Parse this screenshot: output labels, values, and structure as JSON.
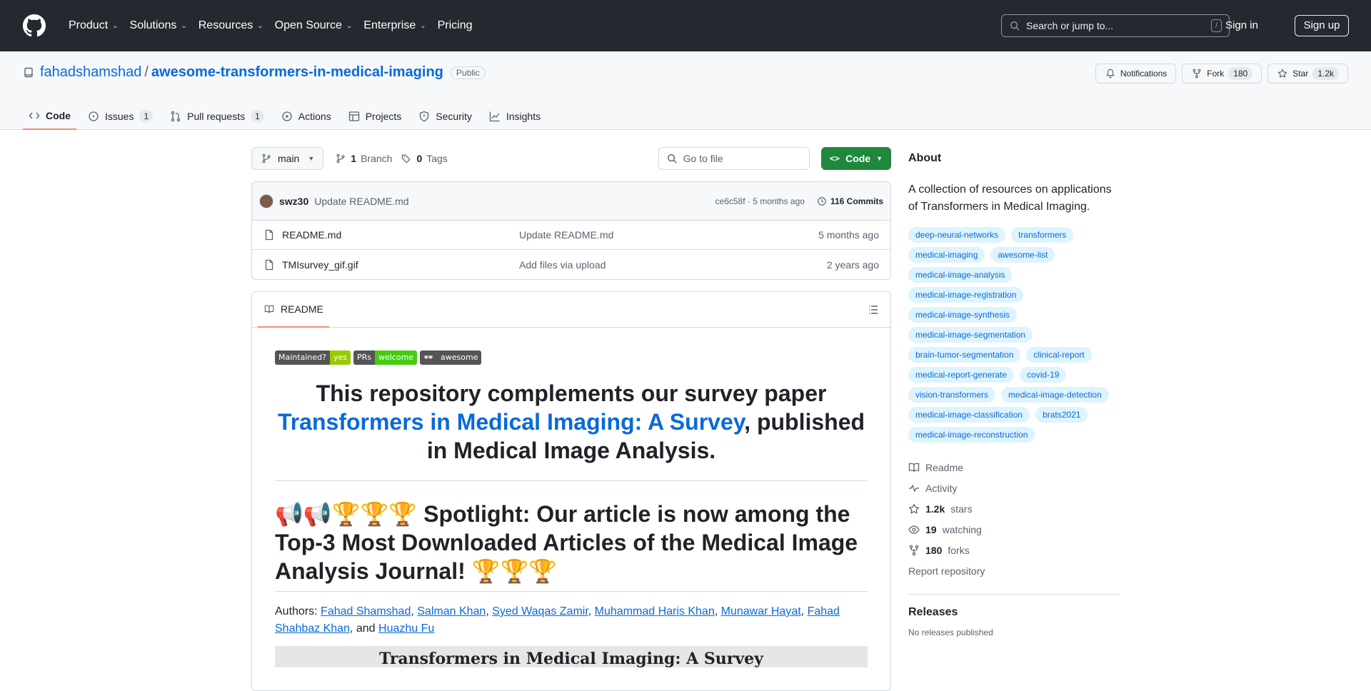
{
  "topnav": {
    "items": [
      {
        "label": "Product",
        "dropdown": true
      },
      {
        "label": "Solutions",
        "dropdown": true
      },
      {
        "label": "Resources",
        "dropdown": true
      },
      {
        "label": "Open Source",
        "dropdown": true
      },
      {
        "label": "Enterprise",
        "dropdown": true
      },
      {
        "label": "Pricing",
        "dropdown": false
      }
    ],
    "search_placeholder": "Search or jump to...",
    "search_shortcut": "/",
    "signin": "Sign in",
    "signup": "Sign up"
  },
  "repo": {
    "owner": "fahadshamshad",
    "separator": "/",
    "name": "awesome-transformers-in-medical-imaging",
    "visibility": "Public",
    "notifications_label": "Notifications",
    "fork_label": "Fork",
    "fork_count": "180",
    "star_label": "Star",
    "star_count": "1.2k"
  },
  "tabs": [
    {
      "label": "Code",
      "count": "",
      "icon": "code-icon"
    },
    {
      "label": "Issues",
      "count": "1",
      "icon": "issue-icon"
    },
    {
      "label": "Pull requests",
      "count": "1",
      "icon": "pull-request-icon"
    },
    {
      "label": "Actions",
      "count": "",
      "icon": "play-icon"
    },
    {
      "label": "Projects",
      "count": "",
      "icon": "table-icon"
    },
    {
      "label": "Security",
      "count": "",
      "icon": "shield-icon"
    },
    {
      "label": "Insights",
      "count": "",
      "icon": "graph-icon"
    }
  ],
  "toolbar": {
    "branch": "main",
    "branch_count": "1",
    "branch_label": "Branch",
    "tag_count": "0",
    "tag_label": "Tags",
    "gofile_placeholder": "Go to file",
    "code_button": "Code"
  },
  "commit": {
    "user": "swz30",
    "message": "Update README.md",
    "sha_time": "ce6c58f · 5 months ago",
    "commits": "116 Commits"
  },
  "files": [
    {
      "name": "README.md",
      "message": "Update README.md",
      "date": "5 months ago"
    },
    {
      "name": "TMIsurvey_gif.gif",
      "message": "Add files via upload",
      "date": "2 years ago"
    }
  ],
  "readme": {
    "tab": "README",
    "shields": [
      {
        "left": "Maintained?",
        "right": "yes",
        "right_color": "#97ca00"
      },
      {
        "left": "PRs",
        "right": "welcome",
        "right_color": "#4c1"
      },
      {
        "left": "🕶",
        "right": "awesome",
        "right_color": "#555"
      }
    ],
    "h1_before": "This repository complements our survey paper",
    "h1_link": "Transformers in Medical Imaging: A Survey",
    "h1_after": ", published in Medical Image Analysis.",
    "h2": "📢📢🏆🏆🏆 Spotlight: Our article is now among the Top-3 Most Downloaded Articles of the Medical Image Analysis Journal! 🏆🏆🏆",
    "authors_prefix": "Authors:",
    "authors": [
      "Fahad Shamshad",
      "Salman Khan",
      "Syed Waqas Zamir",
      "Muhammad Haris Khan",
      "Munawar Hayat",
      "Fahad Shahbaz Khan"
    ],
    "authors_and": ", and",
    "last_author": "Huazhu Fu",
    "paper_image_title": "Transformers in Medical Imaging: A Survey"
  },
  "about": {
    "title": "About",
    "description": "A collection of resources on applications of Transformers in Medical Imaging.",
    "topics": [
      "deep-neural-networks",
      "transformers",
      "medical-imaging",
      "awesome-list",
      "medical-image-analysis",
      "medical-image-registration",
      "medical-image-synthesis",
      "medical-image-segmentation",
      "brain-tumor-segmentation",
      "clinical-report",
      "medical-report-generate",
      "covid-19",
      "vision-transformers",
      "medical-image-detection",
      "medical-image-classification",
      "brats2021",
      "medical-image-reconstruction"
    ],
    "links": [
      {
        "icon": "book-icon",
        "bold": "",
        "label": "Readme"
      },
      {
        "icon": "pulse-icon",
        "bold": "",
        "label": "Activity"
      },
      {
        "icon": "star-icon",
        "bold": "1.2k",
        "label": "stars"
      },
      {
        "icon": "eye-icon",
        "bold": "19",
        "label": "watching"
      },
      {
        "icon": "fork-icon",
        "bold": "180",
        "label": "forks"
      }
    ],
    "report": "Report repository",
    "releases_title": "Releases",
    "no_releases": "No releases published"
  }
}
